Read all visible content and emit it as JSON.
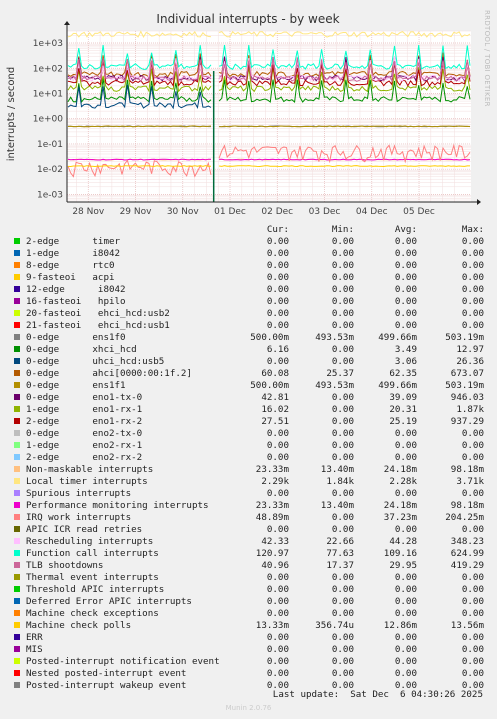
{
  "title": "Individual interrupts - by week",
  "ylabel": "interrupts / second",
  "side_label": "RRDTOOL / TOBI OETIKER",
  "footer": {
    "last_update": "Last update:  Sat Dec  6 04:30:26 2025",
    "version": "Munin 2.0.76"
  },
  "legend_headers": {
    "cur": "Cur:",
    "min": "Min:",
    "avg": "Avg:",
    "max": "Max:"
  },
  "chart_data": {
    "type": "line",
    "title": "Individual interrupts - by week",
    "ylabel": "interrupts / second",
    "xlabel": "",
    "yscale": "log",
    "ylim": [
      0.0005,
      3000
    ],
    "yticks": [
      "1e-03",
      "1e-02",
      "1e-01",
      "1e+00",
      "1e+01",
      "1e+02",
      "1e+03"
    ],
    "xticks": [
      "28 Nov",
      "29 Nov",
      "30 Nov",
      "01 Dec",
      "02 Dec",
      "03 Dec",
      "04 Dec",
      "05 Dec"
    ],
    "grid": true,
    "legend_position": "bottom",
    "series": [
      {
        "name": "2-edge      timer",
        "color": "#00cc00",
        "cur": "0.00",
        "min": "0.00",
        "avg": "0.00",
        "max": "0.00",
        "level": 0
      },
      {
        "name": "1-edge      i8042",
        "color": "#0066b3",
        "cur": "0.00",
        "min": "0.00",
        "avg": "0.00",
        "max": "0.00",
        "level": 0
      },
      {
        "name": "8-edge      rtc0",
        "color": "#ff8000",
        "cur": "0.00",
        "min": "0.00",
        "avg": "0.00",
        "max": "0.00",
        "level": 0
      },
      {
        "name": "9-fasteoi   acpi",
        "color": "#ffcc00",
        "cur": "0.00",
        "min": "0.00",
        "avg": "0.00",
        "max": "0.00",
        "level": 0
      },
      {
        "name": "12-edge      i8042",
        "color": "#330099",
        "cur": "0.00",
        "min": "0.00",
        "avg": "0.00",
        "max": "0.00",
        "level": 0
      },
      {
        "name": "16-fasteoi   hpilo",
        "color": "#990099",
        "cur": "0.00",
        "min": "0.00",
        "avg": "0.00",
        "max": "0.00",
        "level": 0
      },
      {
        "name": "20-fasteoi   ehci_hcd:usb2",
        "color": "#ccff00",
        "cur": "0.00",
        "min": "0.00",
        "avg": "0.00",
        "max": "0.00",
        "level": 0
      },
      {
        "name": "21-fasteoi   ehci_hcd:usb1",
        "color": "#ff0000",
        "cur": "0.00",
        "min": "0.00",
        "avg": "0.00",
        "max": "0.00",
        "level": 0
      },
      {
        "name": "0-edge      ens1f0",
        "color": "#808080",
        "cur": "500.00m",
        "min": "493.53m",
        "avg": "499.66m",
        "max": "503.19m",
        "level": 0.5
      },
      {
        "name": "0-edge      xhci_hcd",
        "color": "#008f00",
        "cur": "6.16",
        "min": "0.00",
        "avg": "3.49",
        "max": "12.97",
        "level": 6
      },
      {
        "name": "0-edge      uhci_hcd:usb5",
        "color": "#00487d",
        "cur": "0.00",
        "min": "0.00",
        "avg": "3.06",
        "max": "26.36",
        "level": 0,
        "early": 3.5
      },
      {
        "name": "0-edge      ahci[0000:00:1f.2]",
        "color": "#b35a00",
        "cur": "60.08",
        "min": "25.37",
        "avg": "62.35",
        "max": "673.07",
        "level": 60
      },
      {
        "name": "0-edge      ens1f1",
        "color": "#b38f00",
        "cur": "500.00m",
        "min": "493.53m",
        "avg": "499.66m",
        "max": "503.19m",
        "level": 0.5
      },
      {
        "name": "0-edge      eno1-tx-0",
        "color": "#6b006b",
        "cur": "42.81",
        "min": "0.00",
        "avg": "39.09",
        "max": "946.03",
        "level": 42
      },
      {
        "name": "1-edge      eno1-rx-1",
        "color": "#8fb300",
        "cur": "16.02",
        "min": "0.00",
        "avg": "20.31",
        "max": "1.87k",
        "level": 16
      },
      {
        "name": "2-edge      eno1-rx-2",
        "color": "#b30000",
        "cur": "27.51",
        "min": "0.00",
        "avg": "25.19",
        "max": "937.29",
        "level": 27
      },
      {
        "name": "0-edge      eno2-tx-0",
        "color": "#bebebe",
        "cur": "0.00",
        "min": "0.00",
        "avg": "0.00",
        "max": "0.00",
        "level": 0
      },
      {
        "name": "1-edge      eno2-rx-1",
        "color": "#80ff80",
        "cur": "0.00",
        "min": "0.00",
        "avg": "0.00",
        "max": "0.00",
        "level": 0
      },
      {
        "name": "2-edge      eno2-rx-2",
        "color": "#80c9ff",
        "cur": "0.00",
        "min": "0.00",
        "avg": "0.00",
        "max": "0.00",
        "level": 0
      },
      {
        "name": "Non-maskable interrupts",
        "color": "#ffc080",
        "cur": "23.33m",
        "min": "13.40m",
        "avg": "24.18m",
        "max": "98.18m",
        "level": 0.024
      },
      {
        "name": "Local timer interrupts",
        "color": "#ffe680",
        "cur": "2.29k",
        "min": "1.84k",
        "avg": "2.28k",
        "max": "3.71k",
        "level": 2290
      },
      {
        "name": "Spurious interrupts",
        "color": "#aa80ff",
        "cur": "0.00",
        "min": "0.00",
        "avg": "0.00",
        "max": "0.00",
        "level": 0
      },
      {
        "name": "Performance monitoring interrupts",
        "color": "#ee00cc",
        "cur": "23.33m",
        "min": "13.40m",
        "avg": "24.18m",
        "max": "98.18m",
        "level": 0.024
      },
      {
        "name": "IRQ work interrupts",
        "color": "#ff8080",
        "cur": "48.89m",
        "min": "0.00",
        "avg": "37.23m",
        "max": "204.25m",
        "level": 0.049
      },
      {
        "name": "APIC ICR read retries",
        "color": "#666600",
        "cur": "0.00",
        "min": "0.00",
        "avg": "0.00",
        "max": "0.00",
        "level": 0
      },
      {
        "name": "Rescheduling interrupts",
        "color": "#ffbfff",
        "cur": "42.33",
        "min": "22.66",
        "avg": "44.28",
        "max": "348.23",
        "level": 42
      },
      {
        "name": "Function call interrupts",
        "color": "#00ffcc",
        "cur": "120.97",
        "min": "77.63",
        "avg": "109.16",
        "max": "624.99",
        "level": 120
      },
      {
        "name": "TLB shootdowns",
        "color": "#cc6699",
        "cur": "40.96",
        "min": "17.37",
        "avg": "29.95",
        "max": "419.29",
        "level": 40
      },
      {
        "name": "Thermal event interrupts",
        "color": "#999900",
        "cur": "0.00",
        "min": "0.00",
        "avg": "0.00",
        "max": "0.00",
        "level": 0
      },
      {
        "name": "Threshold APIC interrupts",
        "color": "#00cc00",
        "cur": "0.00",
        "min": "0.00",
        "avg": "0.00",
        "max": "0.00",
        "level": 0
      },
      {
        "name": "Deferred Error APIC interrupts",
        "color": "#0066b3",
        "cur": "0.00",
        "min": "0.00",
        "avg": "0.00",
        "max": "0.00",
        "level": 0
      },
      {
        "name": "Machine check exceptions",
        "color": "#ff8000",
        "cur": "0.00",
        "min": "0.00",
        "avg": "0.00",
        "max": "0.00",
        "level": 0
      },
      {
        "name": "Machine check polls",
        "color": "#ffcc00",
        "cur": "13.33m",
        "min": "356.74u",
        "avg": "12.86m",
        "max": "13.56m",
        "level": 0.0133
      },
      {
        "name": "ERR",
        "color": "#330099",
        "cur": "0.00",
        "min": "0.00",
        "avg": "0.00",
        "max": "0.00",
        "level": 0
      },
      {
        "name": "MIS",
        "color": "#990099",
        "cur": "0.00",
        "min": "0.00",
        "avg": "0.00",
        "max": "0.00",
        "level": 0
      },
      {
        "name": "Posted-interrupt notification event",
        "color": "#ccff00",
        "cur": "0.00",
        "min": "0.00",
        "avg": "0.00",
        "max": "0.00",
        "level": 0
      },
      {
        "name": "Nested posted-interrupt event",
        "color": "#ff0000",
        "cur": "0.00",
        "min": "0.00",
        "avg": "0.00",
        "max": "0.00",
        "level": 0
      },
      {
        "name": "Posted-interrupt wakeup event",
        "color": "#808080",
        "cur": "0.00",
        "min": "0.00",
        "avg": "0.00",
        "max": "0.00",
        "level": 0
      }
    ]
  }
}
